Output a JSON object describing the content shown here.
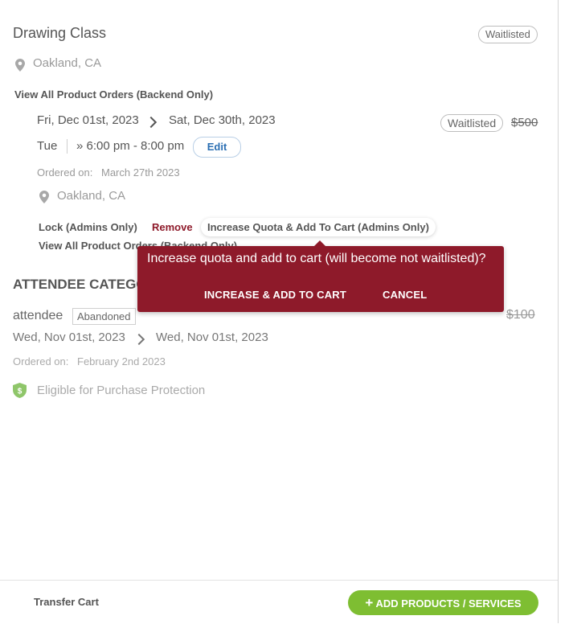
{
  "product": {
    "title": "Drawing Class",
    "status_badge": "Waitlisted",
    "location": "Oakland, CA",
    "view_all_link": "View All Product Orders (Backend Only)"
  },
  "order": {
    "start_date": "Fri, Dec 01st, 2023",
    "end_date": "Sat, Dec 30th, 2023",
    "day": "Tue",
    "time": "» 6:00 pm - 8:00 pm",
    "edit_label": "Edit",
    "status_badge": "Waitlisted",
    "price": "$500",
    "ordered_on_label": "Ordered on:",
    "ordered_on_value": "March 27th 2023",
    "location": "Oakland, CA",
    "actions": {
      "lock": "Lock (Admins Only)",
      "remove": "Remove",
      "increase": "Increase Quota & Add To Cart (Admins Only)"
    },
    "view_all_link": "View All Product Orders (Backend Only)"
  },
  "popover": {
    "message": "Increase quota and add to cart (will become not waitlisted)?",
    "confirm_label": "INCREASE & ADD TO CART",
    "cancel_label": "CANCEL"
  },
  "attendee_section": {
    "heading": "ATTENDEE CATEGORY",
    "name": "attendee",
    "status_badge": "Abandoned",
    "price": "$100",
    "start_date": "Wed, Nov 01st, 2023",
    "end_date": "Wed, Nov 01st, 2023",
    "ordered_on_label": "Ordered on:",
    "ordered_on_value": "February 2nd 2023",
    "protection": "Eligible for Purchase Protection"
  },
  "footer": {
    "transfer_label": "Transfer Cart",
    "add_label": "ADD PRODUCTS / SERVICES"
  },
  "colors": {
    "popover_bg": "#8e1a2a",
    "remove_text": "#8e1a2a",
    "add_button": "#7ebe32",
    "edit_text": "#2b6fb3"
  }
}
